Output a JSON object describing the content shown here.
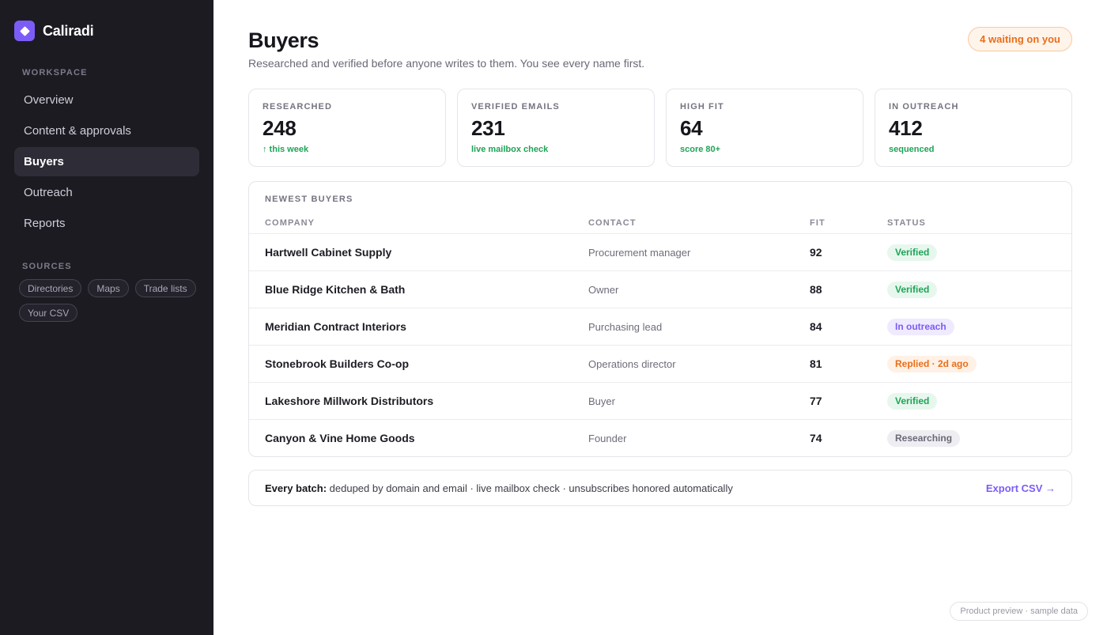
{
  "brand": {
    "name": "Caliradi",
    "logo_icon": "diamond-icon",
    "accent": "#7c5cf6"
  },
  "sidebar": {
    "workspace_label": "WORKSPACE",
    "items": [
      {
        "label": "Overview",
        "active": false
      },
      {
        "label": "Content & approvals",
        "active": false
      },
      {
        "label": "Buyers",
        "active": true
      },
      {
        "label": "Outreach",
        "active": false
      },
      {
        "label": "Reports",
        "active": false
      }
    ],
    "sources_label": "SOURCES",
    "sources": [
      "Directories",
      "Maps",
      "Trade lists",
      "Your CSV"
    ]
  },
  "header": {
    "title": "Buyers",
    "subtitle": "Researched and verified before anyone writes to them. You see every name first.",
    "waiting_badge": "4 waiting on you"
  },
  "stats": [
    {
      "label": "RESEARCHED",
      "value": "248",
      "sub": "↑ this week"
    },
    {
      "label": "VERIFIED EMAILS",
      "value": "231",
      "sub": "live mailbox check"
    },
    {
      "label": "HIGH FIT",
      "value": "64",
      "sub": "score 80+"
    },
    {
      "label": "IN OUTREACH",
      "value": "412",
      "sub": "sequenced"
    }
  ],
  "table": {
    "title": "NEWEST BUYERS",
    "columns": {
      "company": "COMPANY",
      "contact": "CONTACT",
      "fit": "FIT",
      "status": "STATUS"
    },
    "rows": [
      {
        "company": "Hartwell Cabinet Supply",
        "contact": "Procurement manager",
        "fit": "92",
        "status": "Verified",
        "status_type": "verified"
      },
      {
        "company": "Blue Ridge Kitchen & Bath",
        "contact": "Owner",
        "fit": "88",
        "status": "Verified",
        "status_type": "verified"
      },
      {
        "company": "Meridian Contract Interiors",
        "contact": "Purchasing lead",
        "fit": "84",
        "status": "In outreach",
        "status_type": "outreach"
      },
      {
        "company": "Stonebrook Builders Co-op",
        "contact": "Operations director",
        "fit": "81",
        "status": "Replied · 2d ago",
        "status_type": "replied"
      },
      {
        "company": "Lakeshore Millwork Distributors",
        "contact": "Buyer",
        "fit": "77",
        "status": "Verified",
        "status_type": "verified"
      },
      {
        "company": "Canyon & Vine Home Goods",
        "contact": "Founder",
        "fit": "74",
        "status": "Researching",
        "status_type": "researching"
      }
    ]
  },
  "status_colors": {
    "verified": {
      "bg": "#e7f7ee",
      "fg": "#1ea456"
    },
    "outreach": {
      "bg": "#efeafe",
      "fg": "#7c5cf6"
    },
    "replied": {
      "bg": "#fff1e6",
      "fg": "#ea6d1a"
    },
    "researching": {
      "bg": "#eeedf1",
      "fg": "#6b6877"
    }
  },
  "footer": {
    "lead": "Every batch:",
    "text": " deduped by domain and email · live mailbox check · unsubscribes honored automatically",
    "export": "Export CSV →"
  },
  "preview_tag": "Product preview · sample data"
}
